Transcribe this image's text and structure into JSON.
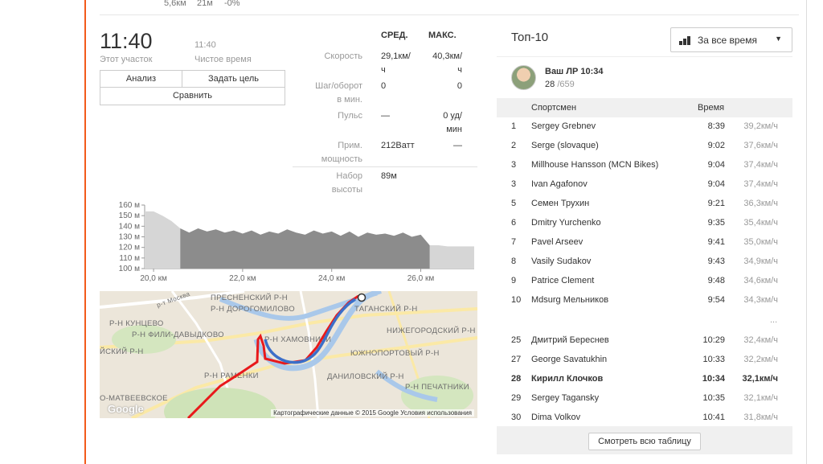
{
  "top_row": {
    "distance": "5,6км",
    "elevation": "21м",
    "grade": "-0%"
  },
  "segment": {
    "time": "11:40",
    "time_label": "Этот участок",
    "elapsed": "11:40",
    "elapsed_label": "Чистое время"
  },
  "buttons": {
    "analysis": "Анализ",
    "set_goal": "Задать цель",
    "compare": "Сравнить"
  },
  "stats": {
    "head_avg": "СРЕД.",
    "head_max": "МАКС.",
    "rows": [
      {
        "label": [
          "Скорость"
        ],
        "avg": [
          "29,1км/",
          "ч"
        ],
        "max": [
          "40,3км/",
          "ч"
        ]
      },
      {
        "label": [
          "Шаг/оборот",
          "в мин."
        ],
        "avg": [
          "0"
        ],
        "max": [
          "0"
        ]
      },
      {
        "label": [
          "Пульс"
        ],
        "avg": [
          "—"
        ],
        "max": [
          "0 уд/",
          "мин"
        ]
      },
      {
        "label": [
          "Прим.",
          "мощность"
        ],
        "avg": [
          "212Ватт"
        ],
        "max": [
          "—"
        ]
      },
      {
        "label": [
          "Набор",
          "высоты"
        ],
        "avg": [
          "89м"
        ],
        "max": [
          ""
        ]
      }
    ]
  },
  "chart_data": {
    "type": "area",
    "x_unit": "km",
    "xlim": [
      19.8,
      27.2
    ],
    "ylim": [
      100,
      160
    ],
    "highlight": [
      20.6,
      26.2
    ],
    "y_ticks": [
      "100 м",
      "110 м",
      "120 м",
      "130 м",
      "140 м",
      "150 м",
      "160 м"
    ],
    "x_ticks": [
      "20,0 км",
      "22,0 км",
      "24,0 км",
      "26,0 км"
    ],
    "x_tick_values": [
      20,
      22,
      24,
      26
    ],
    "x": [
      19.8,
      20.0,
      20.2,
      20.4,
      20.6,
      20.8,
      21.0,
      21.2,
      21.4,
      21.6,
      21.8,
      22.0,
      22.2,
      22.4,
      22.6,
      22.8,
      23.0,
      23.2,
      23.4,
      23.6,
      23.8,
      24.0,
      24.2,
      24.4,
      24.6,
      24.8,
      25.0,
      25.2,
      25.4,
      25.6,
      25.8,
      26.0,
      26.2,
      26.4,
      26.6,
      26.8,
      27.0,
      27.2
    ],
    "y": [
      154,
      154,
      150,
      145,
      138,
      134,
      138,
      135,
      137,
      134,
      136,
      133,
      136,
      132,
      135,
      133,
      137,
      134,
      132,
      136,
      133,
      135,
      131,
      135,
      130,
      134,
      132,
      133,
      131,
      134,
      130,
      132,
      122,
      122,
      121,
      121,
      121,
      121
    ]
  },
  "map": {
    "labels": [
      "ПРЕСНЕНСКИЙ Р-Н",
      "Р-Н ДОРОГОМИЛОВО",
      "Р-Н КУНЦЕВО",
      "Р-Н ФИЛИ-ДАВЫДКОВО",
      "ЙСКИЙ Р-Н",
      "Р-Н ХАМОВНИКИ",
      "ТАГАНСКИЙ Р-Н",
      "НИЖЕГОРОДСКИЙ Р-Н",
      "ЮЖНОПОРТОВЫЙ Р-Н",
      "Р-Н РАМЕНКИ",
      "ДАНИЛОВСКИЙ Р-Н",
      "Р-Н ПЕЧАТНИКИ",
      "О-МАТВЕЕВСКОЕ",
      "р-т Москва"
    ],
    "google": "Google",
    "attribution": "Картографические данные © 2015 Google   Условия использования",
    "route_color": "#e8191b",
    "segment_color": "#3c6fc9"
  },
  "leaderboard": {
    "title": "Топ-10",
    "filter": "За все время",
    "pr_label": "Ваш ЛР 10:34",
    "pr_rank": "28",
    "pr_total": "/659",
    "col_athlete": "Спортсмен",
    "col_time": "Время",
    "ellipsis": "...",
    "rows": [
      {
        "rank": "1",
        "name": "Sergey Grebnev",
        "time": "8:39",
        "speed": "39,2км/ч"
      },
      {
        "rank": "2",
        "name": "Serge (slovaque)",
        "time": "9:02",
        "speed": "37,6км/ч"
      },
      {
        "rank": "3",
        "name": "Millhouse Hansson (MCN Bikes)",
        "time": "9:04",
        "speed": "37,4км/ч"
      },
      {
        "rank": "3",
        "name": "Ivan Agafonov",
        "time": "9:04",
        "speed": "37,4км/ч"
      },
      {
        "rank": "5",
        "name": "Семен Трухин",
        "time": "9:21",
        "speed": "36,3км/ч"
      },
      {
        "rank": "6",
        "name": "Dmitry Yurchenko",
        "time": "9:35",
        "speed": "35,4км/ч"
      },
      {
        "rank": "7",
        "name": "Pavel Arseev",
        "time": "9:41",
        "speed": "35,0км/ч"
      },
      {
        "rank": "8",
        "name": "Vasily Sudakov",
        "time": "9:43",
        "speed": "34,9км/ч"
      },
      {
        "rank": "9",
        "name": "Patrice Clement",
        "time": "9:48",
        "speed": "34,6км/ч"
      },
      {
        "rank": "10",
        "name": "Mdsurg Мельников",
        "time": "9:54",
        "speed": "34,3км/ч"
      },
      {
        "rank": "25",
        "name": "Дмитрий Береснев",
        "time": "10:29",
        "speed": "32,4км/ч"
      },
      {
        "rank": "27",
        "name": "George Savatukhin",
        "time": "10:33",
        "speed": "32,2км/ч"
      },
      {
        "rank": "28",
        "name": "Кирилл Клочков",
        "time": "10:34",
        "speed": "32,1км/ч",
        "me": true
      },
      {
        "rank": "29",
        "name": "Sergey Tagansky",
        "time": "10:35",
        "speed": "32,1км/ч"
      },
      {
        "rank": "30",
        "name": "Dima Volkov",
        "time": "10:41",
        "speed": "31,8км/ч"
      }
    ],
    "see_all": "Смотреть всю таблицу"
  }
}
